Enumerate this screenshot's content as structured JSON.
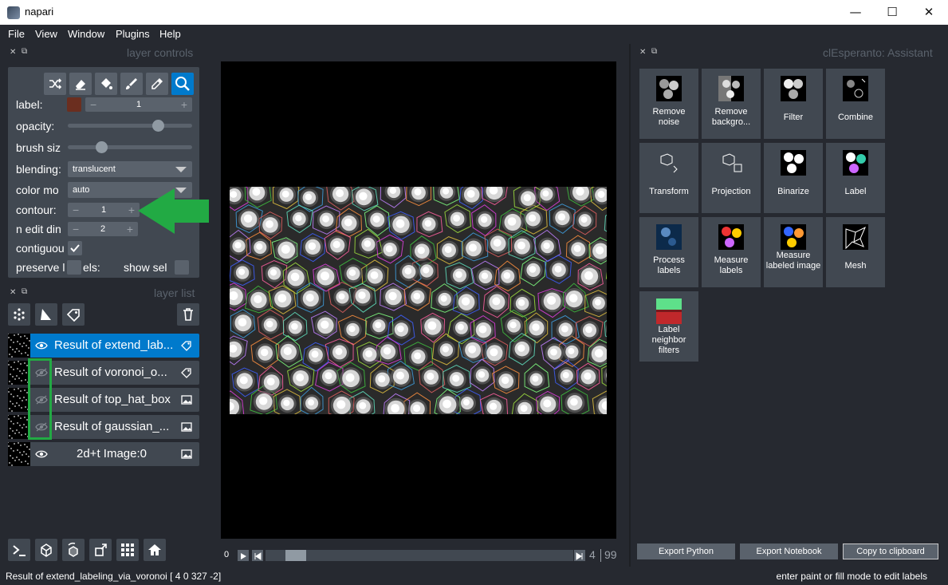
{
  "window": {
    "title": "napari",
    "minimize": "—",
    "maximize": "☐",
    "close": "✕"
  },
  "menu": [
    "File",
    "View",
    "Window",
    "Plugins",
    "Help"
  ],
  "left_dock": {
    "controls_title": "layer controls",
    "list_title": "layer list",
    "close_glyph": "✕",
    "float_glyph": "⧉"
  },
  "controls": {
    "label_label": "label:",
    "label_value": "1",
    "label_color": "#6b2e1f",
    "opacity_label": "opacity:",
    "opacity_value": 0.75,
    "brush_label": "brush siz",
    "brush_value": 0.25,
    "blending_label": "blending:",
    "blending_value": "translucent",
    "colormode_label": "color mo",
    "colormode_value": "auto",
    "contour_label": "contour:",
    "contour_value": "1",
    "ndim_label": "n edit din",
    "ndim_value": "2",
    "contiguous_label": "contiguou",
    "preserve_label": "preserve l",
    "preserve_label2": "els:",
    "showsel_label": "show sel",
    "minus": "−",
    "plus": "+"
  },
  "layers": [
    {
      "name": "Result of extend_lab...",
      "type": "labels-icon",
      "visible": true,
      "selected": true
    },
    {
      "name": "Result of voronoi_o...",
      "type": "labels-icon",
      "visible": false,
      "selected": false
    },
    {
      "name": "Result of top_hat_box",
      "type": "image-icon",
      "visible": false,
      "selected": false
    },
    {
      "name": "Result of gaussian_...",
      "type": "image-icon",
      "visible": false,
      "selected": false
    },
    {
      "name": "2d+t Image:0",
      "type": "image-icon",
      "visible": true,
      "selected": false
    }
  ],
  "player": {
    "frame": "0",
    "right_a": "4",
    "right_b": "99",
    "position": 0.07
  },
  "assistant": {
    "title": "clEsperanto: Assistant",
    "tiles": [
      {
        "label": "Remove noise",
        "icon": "remove-noise-icon"
      },
      {
        "label": "Remove backgro...",
        "icon": "remove-background-icon"
      },
      {
        "label": "Filter",
        "icon": "filter-icon"
      },
      {
        "label": "Combine",
        "icon": "combine-icon"
      },
      {
        "label": "Transform",
        "icon": "transform-icon"
      },
      {
        "label": "Projection",
        "icon": "projection-icon"
      },
      {
        "label": "Binarize",
        "icon": "binarize-icon"
      },
      {
        "label": "Label",
        "icon": "label-icon"
      },
      {
        "label": "Process labels",
        "icon": "process-labels-icon"
      },
      {
        "label": "Measure labels",
        "icon": "measure-labels-icon"
      },
      {
        "label": "Measure labeled image",
        "icon": "measure-labeled-image-icon"
      },
      {
        "label": "Mesh",
        "icon": "mesh-icon"
      },
      {
        "label": "Label neighbor filters",
        "icon": "label-neighbor-filters-icon"
      }
    ],
    "export_python": "Export Python",
    "export_notebook": "Export Notebook",
    "copy_clipboard": "Copy to clipboard"
  },
  "status": {
    "left": "Result of extend_labeling_via_voronoi [  4    0 327  -2]",
    "right": "enter paint or fill mode to edit labels"
  },
  "annotation_color": "#22aa44"
}
